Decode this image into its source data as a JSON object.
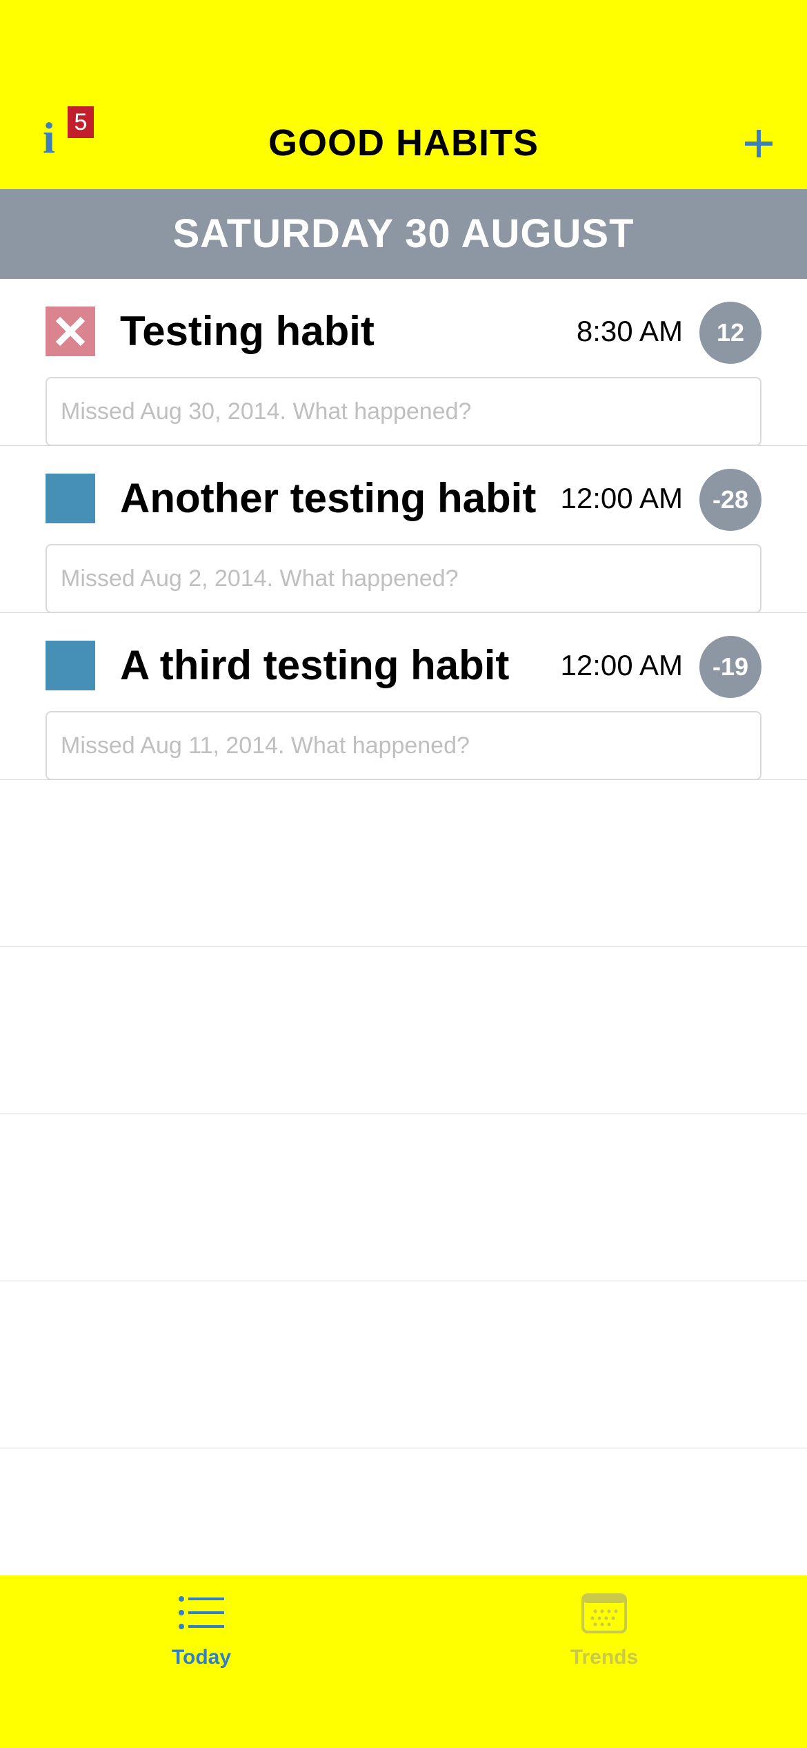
{
  "header": {
    "title": "GOOD HABITS",
    "info_badge_count": "5",
    "info_icon": "info-icon",
    "add_icon": "plus-icon",
    "accent_color": "#ffff00",
    "icon_color": "#3d7fb8"
  },
  "date_bar": {
    "label": "SATURDAY 30 AUGUST",
    "color": "#8c97a3"
  },
  "habits": [
    {
      "name": "Testing habit",
      "time": "8:30 AM",
      "streak": "12",
      "status": "missed",
      "status_icon": "x-mark-icon",
      "note_placeholder": "Missed Aug 30, 2014. What happened?",
      "note_value": ""
    },
    {
      "name": "Another testing habit",
      "time": "12:00 AM",
      "streak": "-28",
      "status": "open",
      "note_placeholder": "Missed Aug 2, 2014. What happened?",
      "note_value": ""
    },
    {
      "name": "A third testing habit",
      "time": "12:00 AM",
      "streak": "-19",
      "status": "open",
      "note_placeholder": "Missed Aug 11, 2014. What happened?",
      "note_value": ""
    }
  ],
  "tabbar": {
    "tabs": [
      {
        "label": "Today",
        "icon": "list-icon",
        "selected": true,
        "color": "#2f80c8"
      },
      {
        "label": "Trends",
        "icon": "calendar-icon",
        "selected": false,
        "color": "#c9c94a"
      }
    ]
  }
}
